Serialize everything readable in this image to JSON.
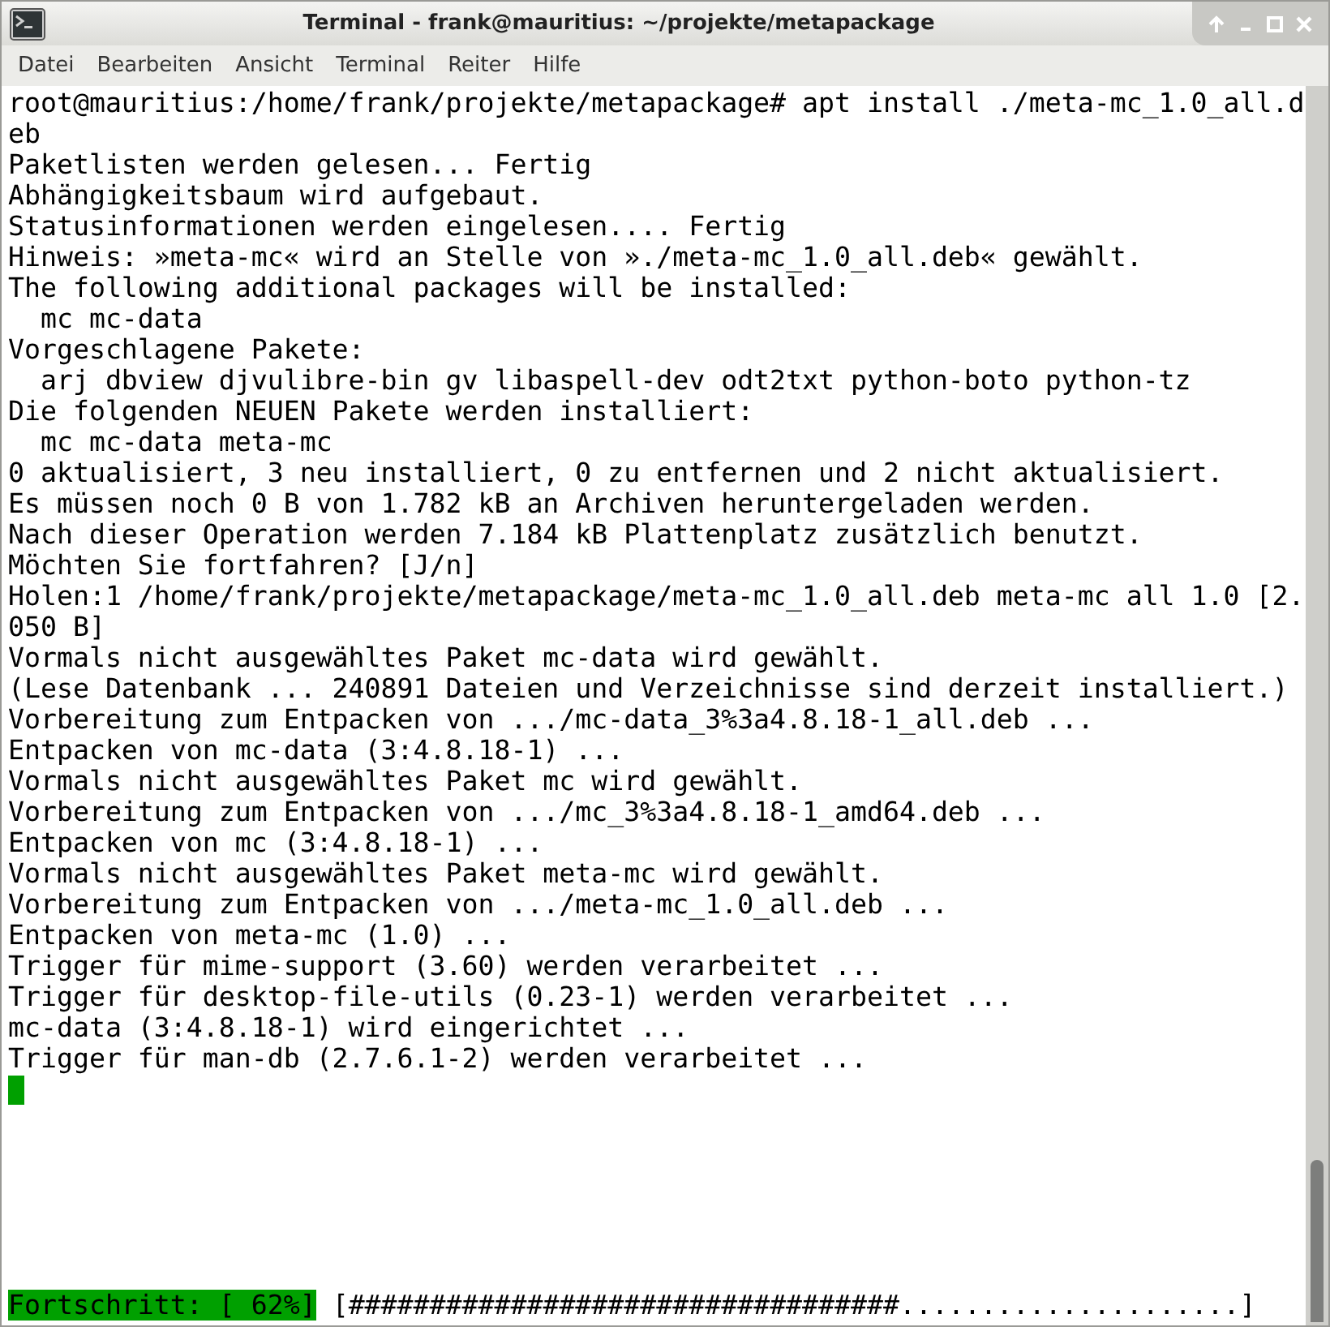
{
  "window": {
    "title": "Terminal - frank@mauritius: ~/projekte/metapackage"
  },
  "menu": [
    "Datei",
    "Bearbeiten",
    "Ansicht",
    "Terminal",
    "Reiter",
    "Hilfe"
  ],
  "terminal": {
    "lines": [
      "root@mauritius:/home/frank/projekte/metapackage# apt install ./meta-mc_1.0_all.d",
      "eb",
      "Paketlisten werden gelesen... Fertig",
      "Abhängigkeitsbaum wird aufgebaut.",
      "Statusinformationen werden eingelesen.... Fertig",
      "Hinweis: »meta-mc« wird an Stelle von »./meta-mc_1.0_all.deb« gewählt.",
      "The following additional packages will be installed:",
      "  mc mc-data",
      "Vorgeschlagene Pakete:",
      "  arj dbview djvulibre-bin gv libaspell-dev odt2txt python-boto python-tz",
      "Die folgenden NEUEN Pakete werden installiert:",
      "  mc mc-data meta-mc",
      "0 aktualisiert, 3 neu installiert, 0 zu entfernen und 2 nicht aktualisiert.",
      "Es müssen noch 0 B von 1.782 kB an Archiven heruntergeladen werden.",
      "Nach dieser Operation werden 7.184 kB Plattenplatz zusätzlich benutzt.",
      "Möchten Sie fortfahren? [J/n]",
      "Holen:1 /home/frank/projekte/metapackage/meta-mc_1.0_all.deb meta-mc all 1.0 [2.",
      "050 B]",
      "Vormals nicht ausgewähltes Paket mc-data wird gewählt.",
      "(Lese Datenbank ... 240891 Dateien und Verzeichnisse sind derzeit installiert.)",
      "Vorbereitung zum Entpacken von .../mc-data_3%3a4.8.18-1_all.deb ...",
      "Entpacken von mc-data (3:4.8.18-1) ...",
      "Vormals nicht ausgewähltes Paket mc wird gewählt.",
      "Vorbereitung zum Entpacken von .../mc_3%3a4.8.18-1_amd64.deb ...",
      "Entpacken von mc (3:4.8.18-1) ...",
      "Vormals nicht ausgewähltes Paket meta-mc wird gewählt.",
      "Vorbereitung zum Entpacken von .../meta-mc_1.0_all.deb ...",
      "Entpacken von meta-mc (1.0) ...",
      "Trigger für mime-support (3.60) werden verarbeitet ...",
      "Trigger für desktop-file-utils (0.23-1) werden verarbeitet ...",
      "mc-data (3:4.8.18-1) wird eingerichtet ...",
      "Trigger für man-db (2.7.6.1-2) werden verarbeitet ..."
    ],
    "progress": {
      "label": "Fortschritt: [ 62%]",
      "bar": "[##################################.....................]"
    }
  }
}
